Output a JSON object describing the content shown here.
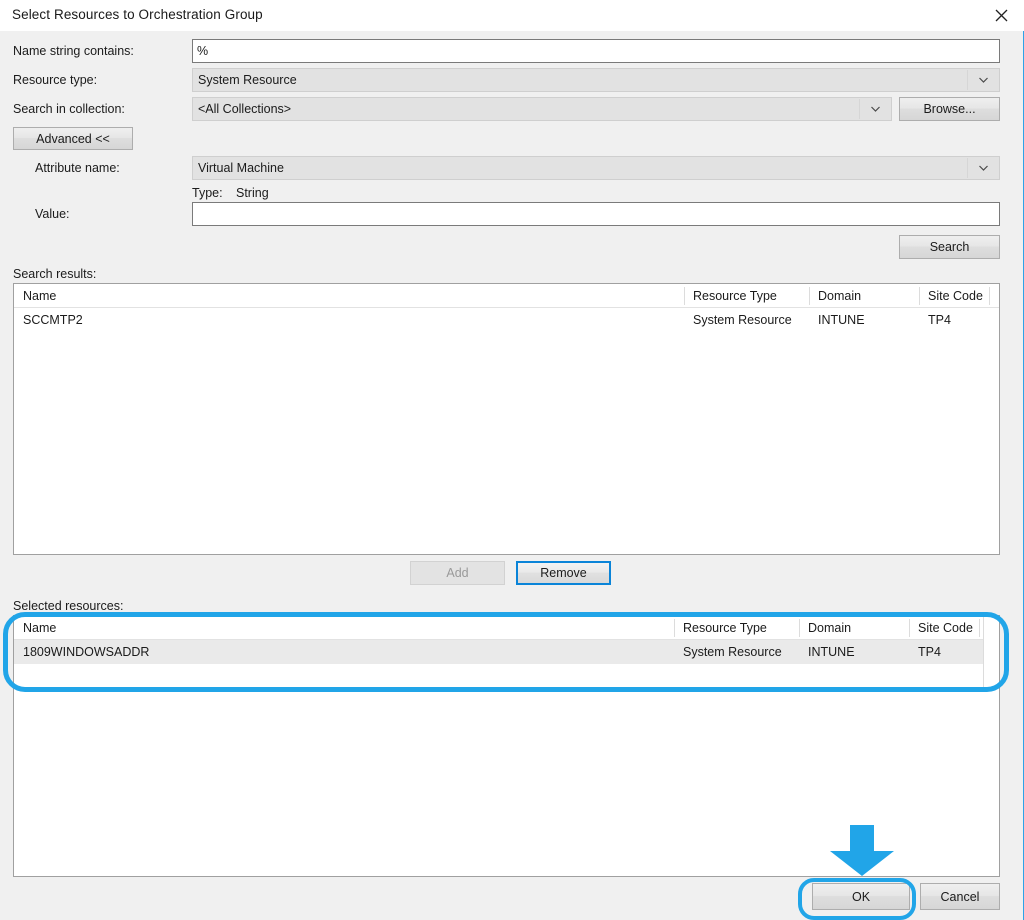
{
  "window": {
    "title": "Select Resources to Orchestration Group",
    "close_icon": "close-icon"
  },
  "form": {
    "name_string_label": "Name string contains:",
    "name_string_value": "%",
    "resource_type_label": "Resource type:",
    "resource_type_value": "System Resource",
    "search_in_collection_label": "Search in collection:",
    "search_in_collection_value": "<All Collections>",
    "browse_label": "Browse...",
    "advanced_label": "Advanced <<",
    "attribute_name_label": "Attribute name:",
    "attribute_name_value": "Virtual Machine",
    "type_label": "Type:",
    "type_value": "String",
    "value_label": "Value:",
    "value_value": "",
    "search_label": "Search"
  },
  "search_results": {
    "caption": "Search results:",
    "columns": [
      "Name",
      "Resource Type",
      "Domain",
      "Site Code"
    ],
    "rows": [
      [
        "SCCMTP2",
        "System Resource",
        "INTUNE",
        "TP4"
      ]
    ]
  },
  "transfer_buttons": {
    "add_label": "Add",
    "add_disabled": true,
    "remove_label": "Remove",
    "remove_focused": true
  },
  "selected_resources": {
    "caption": "Selected resources:",
    "columns": [
      "Name",
      "Resource Type",
      "Domain",
      "Site Code"
    ],
    "rows": [
      [
        "1809WINDOWSADDR",
        "System Resource",
        "INTUNE",
        "TP4"
      ]
    ]
  },
  "footer": {
    "ok_label": "OK",
    "cancel_label": "Cancel"
  },
  "annotations": {
    "highlight_color": "#21a5e8",
    "arrow_icon": "down-arrow-annotation",
    "selected_list_highlight": "selected-resources-highlight",
    "ok_highlight": "ok-button-highlight"
  }
}
